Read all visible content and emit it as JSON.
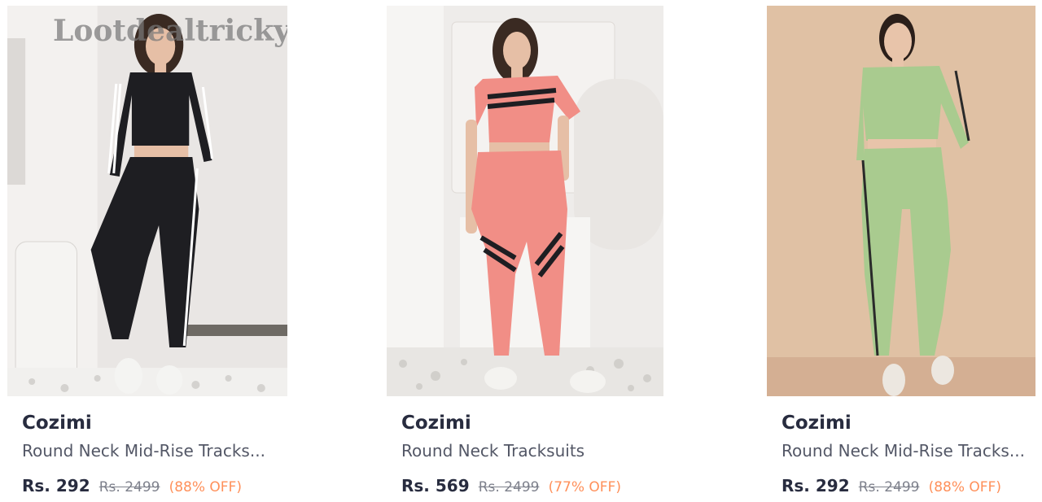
{
  "watermark": "Lootdealtricky",
  "products": [
    {
      "brand": "Cozimi",
      "name": "Round Neck Mid-Rise Tracks...",
      "price": "Rs. 292",
      "mrp": "Rs. 2499",
      "discount": "(88% OFF)",
      "outfit_color": "#1e1e22",
      "stripe_color": "#ffffff",
      "background_color": "#e9e6e4"
    },
    {
      "brand": "Cozimi",
      "name": "Round Neck Tracksuits",
      "price": "Rs. 569",
      "mrp": "Rs. 2499",
      "discount": "(77% OFF)",
      "outfit_color": "#f18e86",
      "stripe_color": "#1e1e22",
      "background_color": "#eeecea"
    },
    {
      "brand": "Cozimi",
      "name": "Round Neck Mid-Rise Tracks...",
      "price": "Rs. 292",
      "mrp": "Rs. 2499",
      "discount": "(88% OFF)",
      "outfit_color": "#a9cb8f",
      "stripe_color": "#2a2a2a",
      "background_color": "#e0c1a4"
    }
  ]
}
